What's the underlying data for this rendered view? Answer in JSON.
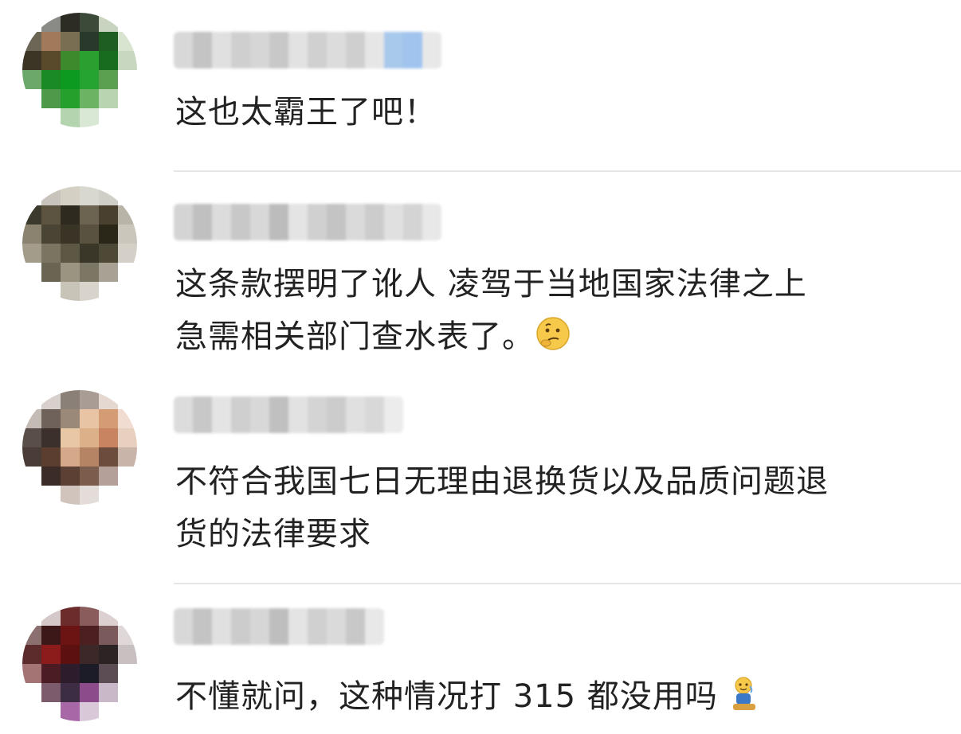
{
  "comments": [
    {
      "text_lines": [
        "这也太霸王了吧！"
      ],
      "avatar_colors": [
        "#ffffff",
        "#8a8a86",
        "#2c2c24",
        "#3c4a3a",
        "#c8d4c0",
        "#ffffff",
        "#6c6656",
        "#a07a5a",
        "#7a6e52",
        "#2a3a2a",
        "#1e5e22",
        "#d8e4d0",
        "#3c3424",
        "#5a4a2c",
        "#3c8a2c",
        "#2aa030",
        "#186c20",
        "#c8d8c0",
        "#6ca86a",
        "#1a8a24",
        "#0c9a20",
        "#26a432",
        "#5aa050",
        "#ffffff",
        "#ffffff",
        "#4c9a4a",
        "#26a02c",
        "#6cb464",
        "#b8d4b0",
        "#ffffff",
        "#ffffff",
        "#ffffff",
        "#b4d4b0",
        "#d8e8d4",
        "#ffffff",
        "#ffffff"
      ],
      "name_colors": [
        "#d8d8d8",
        "#c4c4c4",
        "#e0e0e0",
        "#cfcfcf",
        "#d6d6d6",
        "#c8c8c8",
        "#e2e2e2",
        "#d0d0d0",
        "#dcdcdc",
        "#cfcfcf",
        "#e6e6e6",
        "#a8c8ec",
        "#a0c4ee",
        "#e8e8e8"
      ]
    },
    {
      "text_lines": [
        "这条款摆明了讹人  凌驾于当地国家法律之上",
        "急需相关部门查水表了。"
      ],
      "avatar_colors": [
        "#ffffff",
        "#c8c4bc",
        "#d4d0c4",
        "#d8d8d0",
        "#cfcfc8",
        "#ffffff",
        "#3c3a2c",
        "#5c5440",
        "#2e2a20",
        "#6c6450",
        "#4a4030",
        "#b8b4a8",
        "#8c8270",
        "#4a4434",
        "#3a3426",
        "#5a5240",
        "#2a2618",
        "#cac6bc",
        "#a49c8a",
        "#7a7460",
        "#5c5844",
        "#3a3628",
        "#4e4836",
        "#d4d0c8",
        "#ffffff",
        "#6a6452",
        "#9a9480",
        "#7c7664",
        "#a8a294",
        "#ffffff",
        "#ffffff",
        "#ffffff",
        "#c8c4b8",
        "#d8d4cc",
        "#ffffff",
        "#ffffff"
      ],
      "name_colors": [
        "#d4d4d4",
        "#c0c0c0",
        "#dcdcdc",
        "#c8c8c8",
        "#d8d8d8",
        "#bcbcbc",
        "#e4e4e4",
        "#d0d0d0",
        "#c4c4c4",
        "#dadada",
        "#cccccc",
        "#e0e0e0",
        "#d4d4d4",
        "#e8e8e8"
      ]
    },
    {
      "text_lines": [
        "不符合我国七日无理由退换货以及品质问题退",
        "货的法律要求"
      ],
      "avatar_colors": [
        "#ffffff",
        "#d8d0cc",
        "#8a8078",
        "#a89c94",
        "#e4d8d0",
        "#ffffff",
        "#c4bcb4",
        "#6e625a",
        "#9a8878",
        "#e8c4a4",
        "#d49c74",
        "#f0dcd0",
        "#5a4e48",
        "#3c302c",
        "#e8c8a4",
        "#dcb088",
        "#c88460",
        "#e8d0c0",
        "#4a3c36",
        "#5c3e30",
        "#d4a888",
        "#b48464",
        "#6c4c3c",
        "#c8b4a8",
        "#ffffff",
        "#3c2c28",
        "#5c4034",
        "#7c5c4c",
        "#b4a098",
        "#ffffff",
        "#ffffff",
        "#ffffff",
        "#d0c4bc",
        "#e4dcd8",
        "#ffffff",
        "#ffffff"
      ],
      "name_colors": [
        "#dcdcdc",
        "#c8c8c8",
        "#e4e4e4",
        "#cfcfcf",
        "#d8d8d8",
        "#c0c0c0",
        "#e2e2e2",
        "#d4d4d4",
        "#cccccc",
        "#e0e0e0",
        "#d8d8d8",
        "#ececec"
      ]
    },
    {
      "text_lines": [
        "不懂就问，这种情况打 315 都没用吗"
      ],
      "avatar_colors": [
        "#ffffff",
        "#d4c8c8",
        "#6c2c2c",
        "#8a5c5c",
        "#dcd0d0",
        "#ffffff",
        "#8c7070",
        "#3c1818",
        "#6c1414",
        "#4c2020",
        "#7a5a5a",
        "#e0d8d8",
        "#5c2c2c",
        "#8c1c1c",
        "#5c1010",
        "#3c2828",
        "#2c2424",
        "#c8c0c0",
        "#a47474",
        "#4c1c24",
        "#2c1c2c",
        "#1c1c28",
        "#5c4c54",
        "#ffffff",
        "#ffffff",
        "#7c5c6c",
        "#3c2c44",
        "#8c4c8c",
        "#c8b8c8",
        "#ffffff",
        "#ffffff",
        "#ffffff",
        "#a868a8",
        "#d8c8d8",
        "#ffffff",
        "#ffffff"
      ],
      "name_colors": [
        "#d8d8d8",
        "#c4c4c4",
        "#e0e0e0",
        "#cccccc",
        "#d6d6d6",
        "#bebebe",
        "#e4e4e4",
        "#d0d0d0",
        "#dadada",
        "#c8c8c8",
        "#e8e8e8"
      ]
    }
  ]
}
